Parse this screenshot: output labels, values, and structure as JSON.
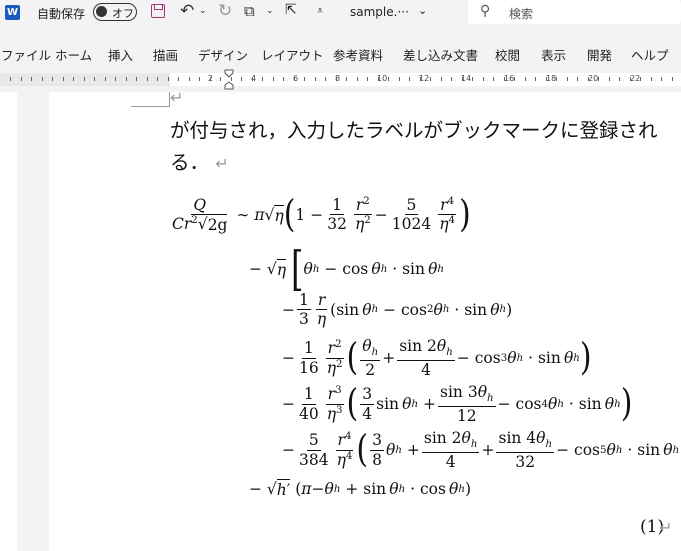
{
  "titlebar": {
    "logo": "W",
    "autosave_label": "自動保存",
    "toggle_label": "オフ",
    "file_name": "sample.···",
    "search_placeholder": "検索",
    "icons": [
      "word-logo-icon",
      "save-icon",
      "undo-icon",
      "redo-icon",
      "shape-icon",
      "pointer-icon",
      "customize-qat-icon",
      "chevron-down-icon",
      "search-icon"
    ]
  },
  "ribbon": {
    "tabs": [
      "ファイル",
      "ホーム",
      "挿入",
      "描画",
      "デザイン",
      "レイアウト",
      "参考資料",
      "差し込み文書",
      "校閲",
      "表示",
      "開発",
      "ヘルプ"
    ]
  },
  "ruler": {
    "labels": [
      "2",
      "4",
      "6",
      "8",
      "10",
      "12",
      "14",
      "16",
      "18",
      "20",
      "22"
    ]
  },
  "document": {
    "line1": "が付与され，入力したラベルがブックマークに登録され",
    "line2": "る．",
    "equation_number": "(1)"
  }
}
